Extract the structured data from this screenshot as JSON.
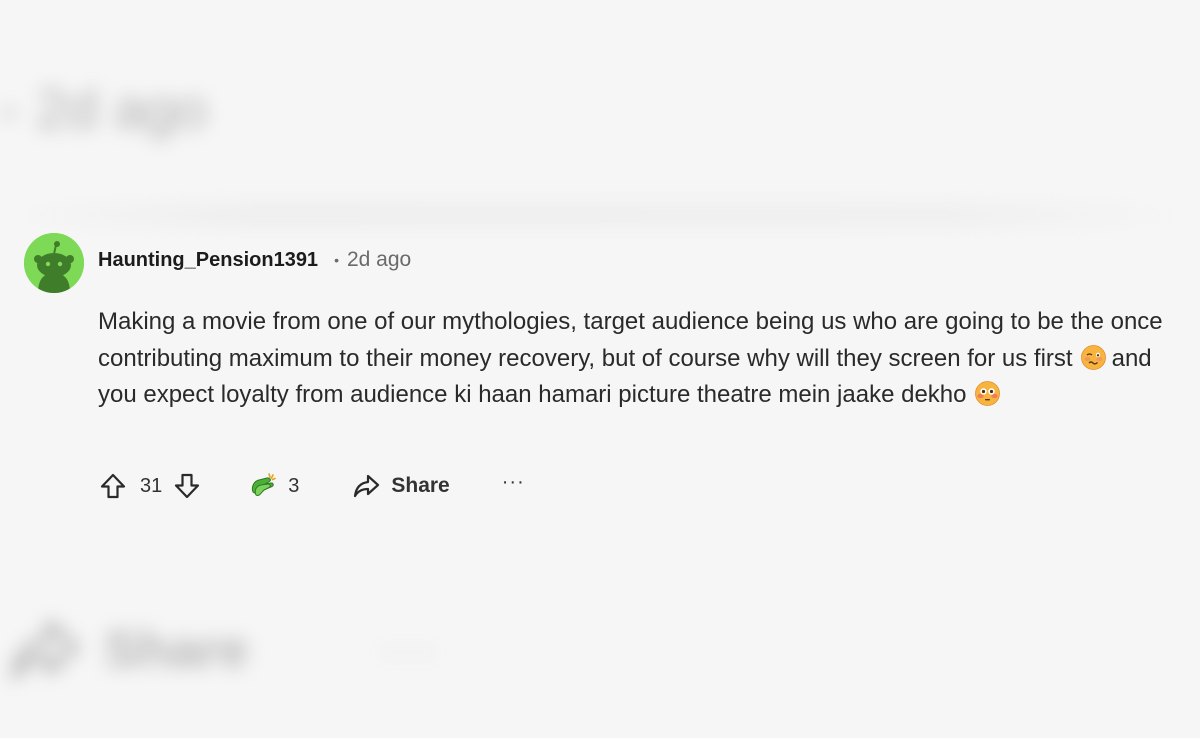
{
  "background": {
    "top_blurred_text": "2d ago",
    "bottom_share_label": "Share",
    "bottom_more": "····"
  },
  "comment": {
    "username": "Haunting_Pension1391",
    "separator": "•",
    "timestamp": "2d ago",
    "avatar_color": "#7ed957",
    "body": {
      "part1": "Making a movie from one of our mythologies, target audience being us who are going to be the once contributing maximum to their money recovery, but of course why will they screen for us first",
      "emoji1": "woozy-face-emoji",
      "part2": "and you expect loyalty from audience ki haan hamari picture theatre mein jaake dekho",
      "emoji2": "flushed-face-emoji"
    },
    "actions": {
      "vote_score": "31",
      "award_count": "3",
      "share_label": "Share",
      "more_label": "···"
    }
  }
}
